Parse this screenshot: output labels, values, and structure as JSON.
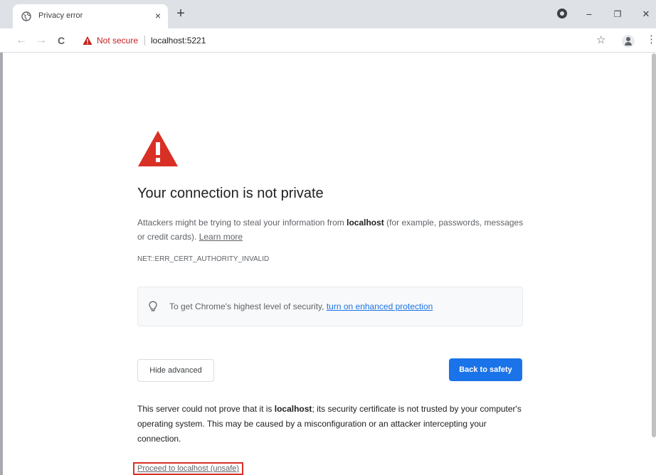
{
  "tab": {
    "title": "Privacy error",
    "favicon": "globe-icon",
    "close_label": "×"
  },
  "window": {
    "new_tab_label": "+",
    "minimize_label": "−",
    "restore_label": "❐",
    "close_label": "✕"
  },
  "toolbar": {
    "back_label": "←",
    "forward_label": "→",
    "reload_label": "C",
    "security_label": "Not secure",
    "url": "localhost:5221",
    "star_label": "☆",
    "menu_label": "⋮"
  },
  "page": {
    "heading": "Your connection is not private",
    "intro_before": "Attackers might be trying to steal your information from ",
    "intro_host": "localhost",
    "intro_after": " (for example, passwords, messages or credit cards). ",
    "learn_more": "Learn more",
    "error_code": "NET::ERR_CERT_AUTHORITY_INVALID",
    "enhanced_text": "To get Chrome's highest level of security, ",
    "enhanced_link": "turn on enhanced protection",
    "hide_advanced": "Hide advanced",
    "back_to_safety": "Back to safety",
    "details_before": "This server could not prove that it is ",
    "details_host": "localhost",
    "details_after": "; its security certificate is not trusted by your computer's operating system. This may be caused by a misconfiguration or an attacker intercepting your connection.",
    "proceed_link": "Proceed to localhost (unsafe)"
  },
  "colors": {
    "warning_red": "#d93025",
    "primary_blue": "#1a73e8"
  }
}
